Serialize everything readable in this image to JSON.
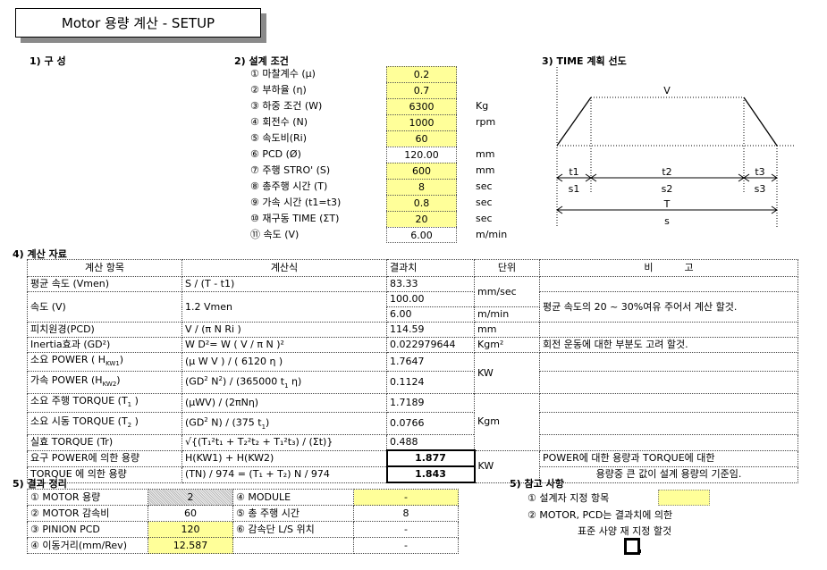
{
  "title": "Motor 용량 계산 - SETUP",
  "sections": {
    "s1": "1) 구 성",
    "s2": "2) 설계 조건",
    "s3": "3) TIME 계획 선도",
    "s4": "4) 계산 자료",
    "s5": "5) 결과 정리",
    "s6": "5) 참고 사항"
  },
  "conditions": [
    {
      "label": "① 마찰계수 (μ)",
      "value": "0.2",
      "unit": "",
      "input": true
    },
    {
      "label": "② 부하율 (η)",
      "value": "0.7",
      "unit": "",
      "input": true
    },
    {
      "label": "③ 하중 조건 (W)",
      "value": "6300",
      "unit": "Kg",
      "input": true
    },
    {
      "label": "④ 회전수 (N)",
      "value": "1000",
      "unit": "rpm",
      "input": true
    },
    {
      "label": "⑤ 속도비(Ri)",
      "value": "60",
      "unit": "",
      "input": true
    },
    {
      "label": "⑥ PCD (Ø)",
      "value": "120.00",
      "unit": "mm",
      "input": false
    },
    {
      "label": "⑦ 주행 STRO' (S)",
      "value": "600",
      "unit": "mm",
      "input": true
    },
    {
      "label": "⑧ 총주행 시간 (T)",
      "value": "8",
      "unit": "sec",
      "input": true
    },
    {
      "label": "⑨ 가속 시간 (t1=t3)",
      "value": "0.8",
      "unit": "sec",
      "input": true
    },
    {
      "label": "⑩ 재구동 TIME (ΣT)",
      "value": "20",
      "unit": "sec",
      "input": true
    },
    {
      "label": "⑪ 속도 (V)",
      "value": "6.00",
      "unit": "m/min",
      "input": false
    }
  ],
  "diagram": {
    "v": "V",
    "t1": "t1",
    "t2": "t2",
    "t3": "t3",
    "s1": "s1",
    "s2": "s2",
    "s3": "s3",
    "T": "T",
    "s": "s"
  },
  "calc": {
    "headers": [
      "계산 항목",
      "계산식",
      "결과치",
      "단위",
      "비          고"
    ],
    "rows": {
      "vmen": {
        "item": "평균 속도 (Vmen)",
        "formula": "S / (T - t1)",
        "result": "83.33"
      },
      "v": {
        "item": "속도 (V)",
        "formula": "1.2 Vmen",
        "result1": "100.00",
        "result2": "6.00"
      },
      "pcd": {
        "item": "피치원경(PCD)",
        "formula": "V / (π N Ri )",
        "result": "114.59",
        "unit": "mm"
      },
      "gd2": {
        "item": "Inertia효과 (GD²)",
        "formula": "W D²= W ( V / π N )²",
        "result": "0.022979644",
        "unit": "Kgm²",
        "note": "회전 운동에 대한 부분도 고려 할것."
      },
      "hkw1": {
        "item": "소요 POWER ( H",
        "item_sub": "KW1",
        "item_end": ")",
        "formula": "(μ W V ) / ( 6120 η )",
        "result": "1.7647"
      },
      "hkw2": {
        "item": "가속 POWER (H",
        "item_sub": "KW2",
        "item_end": ")",
        "formula_a": "(GD",
        "formula_b": " N",
        "formula_c": ") / (365000 t",
        "formula_d": " η)",
        "result": "0.1124"
      },
      "t1": {
        "item": "소요 주행 TORQUE (T",
        "item_sub": "1",
        "item_end": " )",
        "formula": "(μWV) / (2πNη)",
        "result": "1.7189"
      },
      "t2": {
        "item": "소요 시동 TORQUE (T",
        "item_sub": "2",
        "item_end": " )",
        "formula_a": "(GD",
        "formula_b": " N) / (375 t",
        "formula_c": ")",
        "result": "0.0766"
      },
      "tr": {
        "item": "실효 TORQUE (Tr)",
        "formula": "√{(T₁²t₁ + T₂²t₂ + T₁²t₃) / (Σt)}",
        "result": "0.488"
      },
      "req_power": {
        "item": "요구 POWER에 의한 용량",
        "formula": "H(KW1) + H(KW2)",
        "result": "1.877",
        "note": "POWER에 대한 용량과 TORQUE에 대한"
      },
      "req_torque": {
        "item": "TORQUE 에 의한 용량",
        "formula": "(TN) / 974 = (T₁ + T₂) N / 974",
        "result": "1.843",
        "note": "용량중 큰 값이 설계 용량의 기준임."
      }
    },
    "units": {
      "mmsec": "mm/sec",
      "mmin": "m/min",
      "kw": "KW",
      "kgm": "Kgm"
    },
    "note_speed": "평균 속도의 20 ~ 30%여유 주어서 계산 할것."
  },
  "summary": [
    {
      "l1": "① MOTOR 용량",
      "v1": "2",
      "l2": "④ MODULE",
      "v2": "-"
    },
    {
      "l1": "② MOTOR 감속비",
      "v1": "60",
      "l2": "⑤ 총 주행 시간",
      "v2": "8"
    },
    {
      "l1": "③ PINION PCD",
      "v1": "120",
      "l2": "⑥ 감속단 L/S 위치",
      "v2": "-"
    },
    {
      "l1": "④ 이동거리(mm/Rev)",
      "v1": "12.587",
      "l2": "",
      "v2": "-"
    }
  ],
  "notes": {
    "n1": "① 설계자 지정 항목",
    "n2": "② MOTOR, PCD는 결과치에 의한",
    "n3": "표준 사양 재 지정 할것"
  },
  "colors": {
    "input_yellow": "#ffff99"
  }
}
